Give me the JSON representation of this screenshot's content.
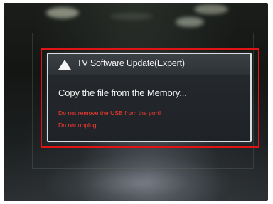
{
  "dialog": {
    "title": "TV Software Update(Expert)",
    "icon": "warning-triangle-icon",
    "message": "Copy the file from the Memory...",
    "warnings": [
      "Do not remove the USB from the port!",
      "Do not unplug!"
    ]
  },
  "colors": {
    "highlight_frame": "#e01414",
    "warning_text": "#ff3b30",
    "dialog_background": "#23272b",
    "dialog_border": "#d9dee2",
    "primary_text": "#f0f0f0"
  }
}
